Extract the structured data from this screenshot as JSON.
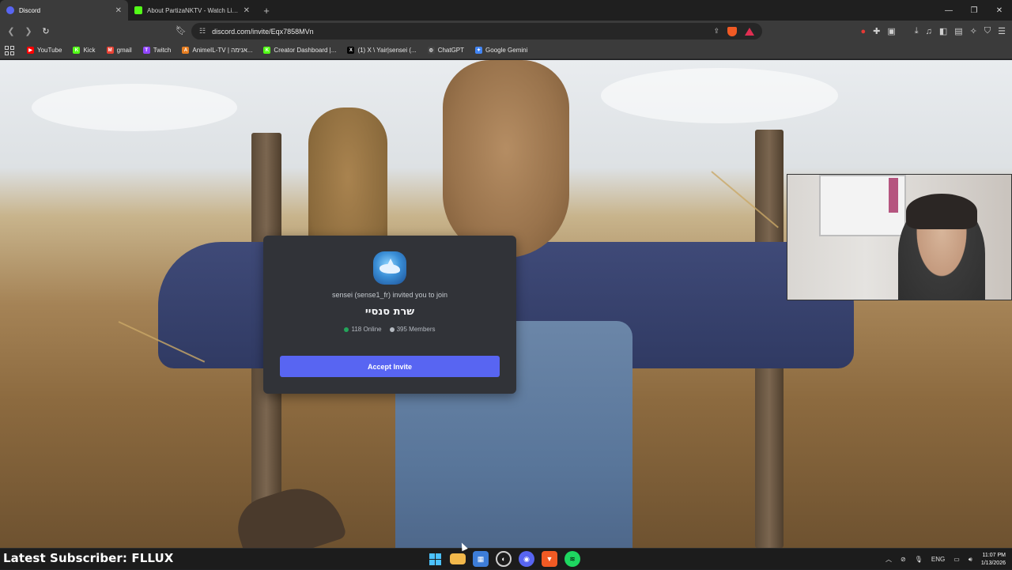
{
  "browser": {
    "tabs": [
      {
        "title": "Discord",
        "active": true,
        "favicon_color": "#5865f2"
      },
      {
        "title": "About PartizaNKTV - Watch Live on K",
        "active": false,
        "favicon_color": "#53fc18"
      }
    ],
    "address": "discord.com/invite/Eqx7858MVn",
    "bookmarks": [
      {
        "label": "YouTube",
        "color": "#ff0000",
        "glyph": "▶"
      },
      {
        "label": "Kick",
        "color": "#53fc18",
        "glyph": "K"
      },
      {
        "label": "gmail",
        "color": "#ea4335",
        "glyph": "M"
      },
      {
        "label": "Twitch",
        "color": "#9146ff",
        "glyph": "T"
      },
      {
        "label": "AnimeIL-TV | אנימה...",
        "color": "#e67e22",
        "glyph": "A"
      },
      {
        "label": "Creator Dashboard |...",
        "color": "#53fc18",
        "glyph": "K"
      },
      {
        "label": "(1) X \\ Yair|sensei (...",
        "color": "#000000",
        "glyph": "X"
      },
      {
        "label": "ChatGPT",
        "color": "#444444",
        "glyph": "◎"
      },
      {
        "label": "Google Gemini",
        "color": "#4285f4",
        "glyph": "✦"
      }
    ]
  },
  "invite": {
    "invited_text": "sensei (sense1_fr) invited you to join",
    "server_name": "שרת סנסיי",
    "online": "118 Online",
    "members": "395 Members",
    "online_color": "#23a55a",
    "members_color": "#b5bac1",
    "accept_label": "Accept Invite",
    "accent": "#5865f2"
  },
  "stream_overlay": {
    "latest_subscriber": "Latest Subscriber: FLLUX"
  },
  "taskbar": {
    "language": "ENG",
    "time": "11:07 PM",
    "date": "1/13/2026"
  }
}
